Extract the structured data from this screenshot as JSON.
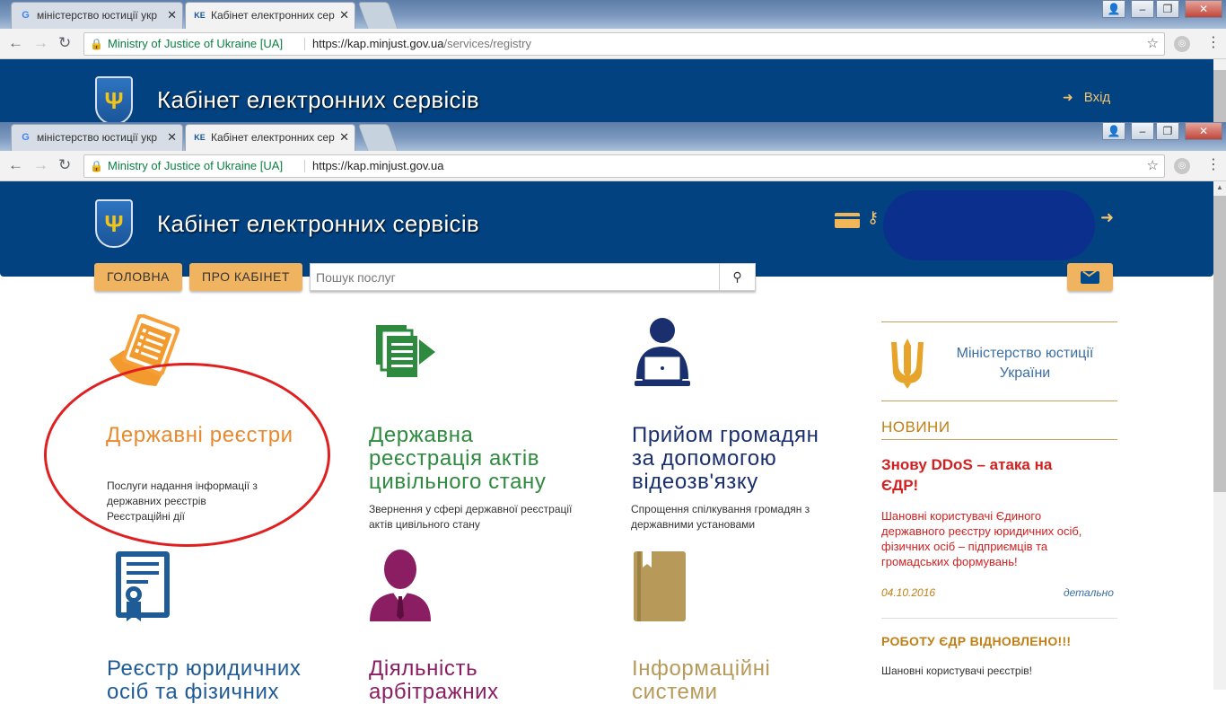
{
  "back_window": {
    "tabs": [
      {
        "icon": "google-icon",
        "label": "міністерство юстиції укр"
      },
      {
        "icon": "kes-icon",
        "label": "Кабінет електронних сер"
      }
    ],
    "address": {
      "secure_label": "Ministry of Justice of Ukraine [UA]",
      "url_base": "https://kap.minjust.gov.ua",
      "url_path": "/services/registry"
    },
    "site": {
      "title": "Кабінет електронних сервісів",
      "login_label": "Вхід"
    }
  },
  "front_window": {
    "tabs": [
      {
        "icon": "google-icon",
        "label": "міністерство юстиції укр"
      },
      {
        "icon": "kes-icon",
        "label": "Кабінет електронних сер"
      }
    ],
    "address": {
      "secure_label": "Ministry of Justice of Ukraine [UA]",
      "url_base": "https://kap.minjust.gov.ua",
      "url_path": ""
    }
  },
  "site": {
    "title": "Кабінет електронних сервісів",
    "nav": {
      "home": "ГОЛОВНА",
      "about": "ПРО КАБІНЕТ"
    },
    "search": {
      "placeholder": "Пошук послуг"
    }
  },
  "tiles": [
    {
      "title": "Державні реєстри",
      "desc_lines": [
        "Послуги надання інформації з",
        "державних реєстрів",
        "Реєстраційні дії"
      ],
      "color": "#e8892e"
    },
    {
      "title": "Державна реєстрація актів цивільного стану",
      "title_lines": [
        "Державна",
        "реєстрація актів",
        "цивільного стану"
      ],
      "desc_lines": [
        "Звернення у сфері державної реєстрації",
        "актів цивільного стану"
      ],
      "color": "#2e8a3e"
    },
    {
      "title": "Прийом громадян за допомогою відеозв'язку",
      "title_lines": [
        "Прийом громадян",
        "за допомогою",
        "відеозв'язку"
      ],
      "desc_lines": [
        "Спрощення спілкування громадян з",
        "державними установами"
      ],
      "color": "#1a2f6e"
    },
    {
      "title_lines": [
        "Реєстр юридичних",
        "осіб та фізичних"
      ],
      "color": "#1f5b97"
    },
    {
      "title_lines": [
        "Діяльність",
        "арбітражних"
      ],
      "color": "#8b1e62"
    },
    {
      "title_lines": [
        "Інформаційні",
        "системи"
      ],
      "color": "#b79a5a"
    }
  ],
  "sidebar": {
    "ministry_name_lines": [
      "Міністерство юстиції",
      "України"
    ],
    "news_heading": "НОВИНИ",
    "news": [
      {
        "title_lines": [
          "Знову DDoS – атака на",
          "ЄДР!"
        ],
        "text_lines": [
          "Шановні користувачі Єдиного",
          "державного реєстру юридичних осіб,",
          "фізичних осіб – підприємців та",
          "громадських формувань!"
        ],
        "date": "04.10.2016",
        "more": "детально"
      },
      {
        "title": "РОБОТУ ЄДР ВІДНОВЛЕНО!!!",
        "text": "Шановні користувачі реєстрів!"
      }
    ]
  },
  "colors": {
    "header_blue": "#024281",
    "nav_orange": "#f0b460",
    "accent_gold": "#c27f14",
    "news_red": "#d22020",
    "annotation_red": "#e02020"
  }
}
